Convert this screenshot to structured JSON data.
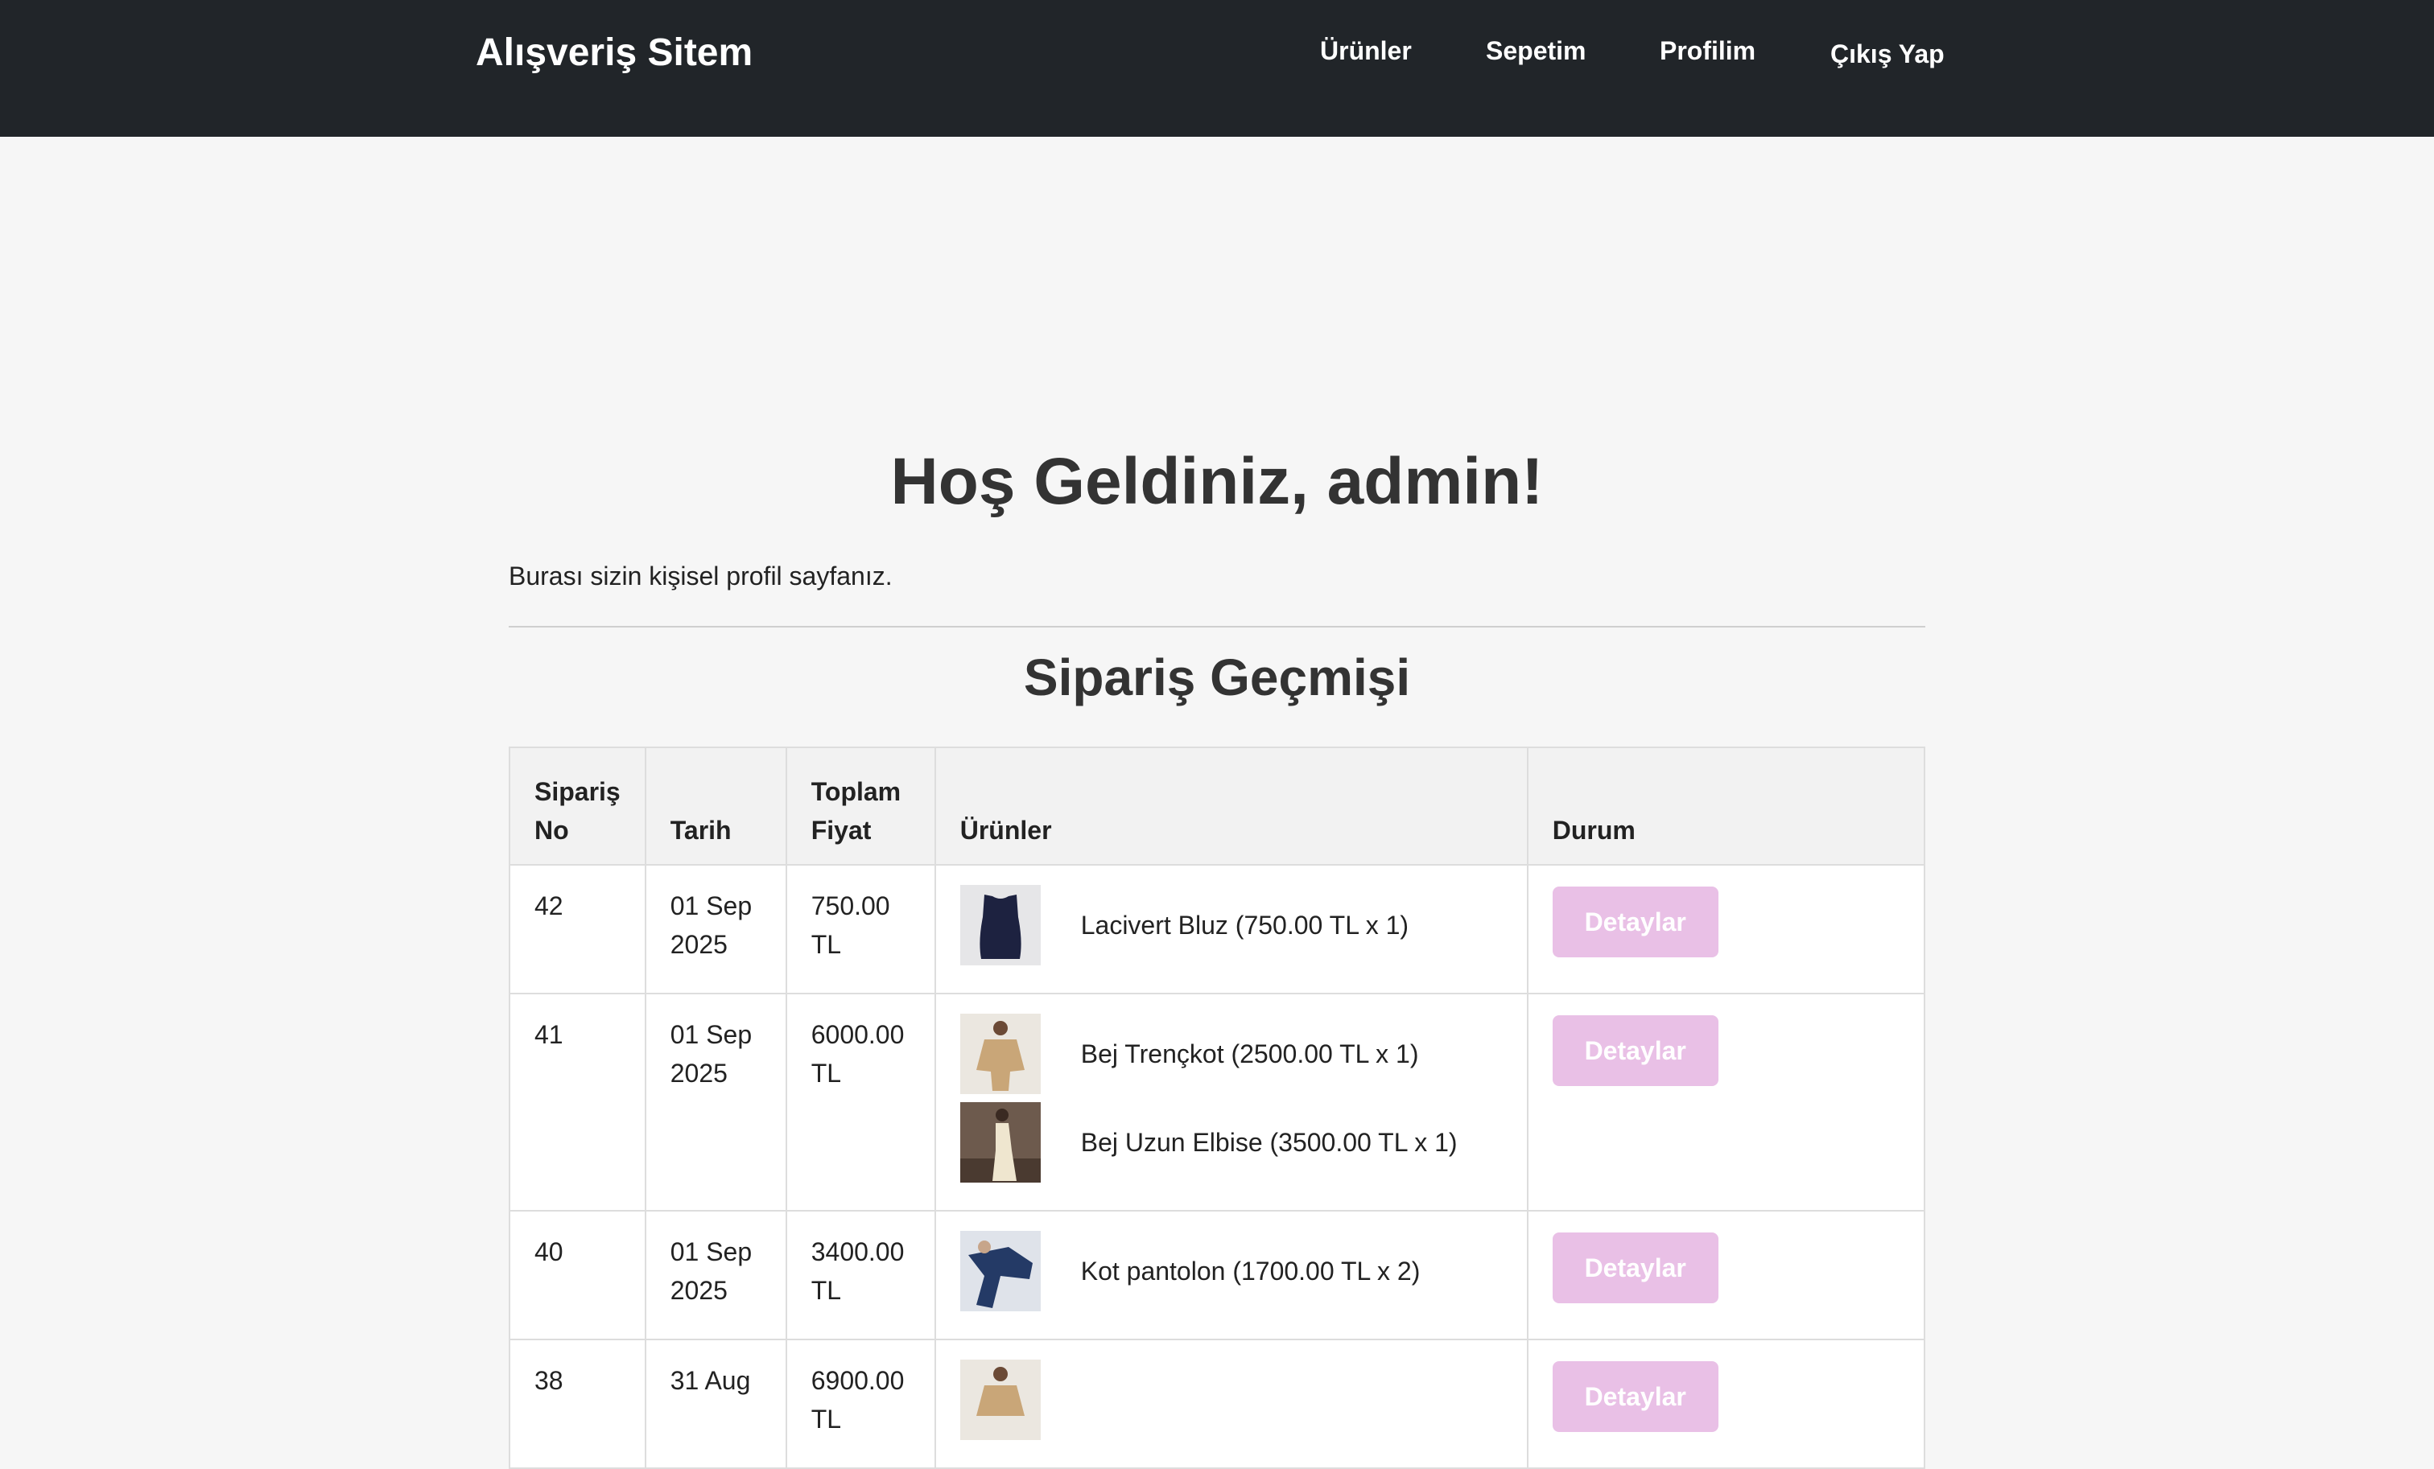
{
  "navbar": {
    "brand": "Alışveriş Sitem",
    "links": [
      "Ürünler",
      "Sepetim",
      "Profilim",
      "Çıkış Yap"
    ]
  },
  "profile": {
    "welcome": "Hoş Geldiniz, admin!",
    "intro": "Burası sizin kişisel profil sayfanız.",
    "history_title": "Sipariş Geçmişi"
  },
  "table": {
    "headers": [
      "Sipariş No",
      "Tarih",
      "Toplam Fiyat",
      "Ürünler",
      "Durum"
    ],
    "rows": [
      {
        "id": "42",
        "date": "01 Sep 2025",
        "total": "750.00 TL",
        "products": [
          {
            "name": "Lacivert Bluz (750.00 TL x 1)",
            "icon": "navy-blouse-thumbnail"
          }
        ],
        "action": "Detaylar"
      },
      {
        "id": "41",
        "date": "01 Sep 2025",
        "total": "6000.00 TL",
        "products": [
          {
            "name": "Bej Trençkot (2500.00 TL x 1)",
            "icon": "beige-trench-coat-thumbnail"
          },
          {
            "name": "Bej Uzun Elbise (3500.00 TL x 1)",
            "icon": "beige-long-dress-thumbnail"
          }
        ],
        "action": "Detaylar"
      },
      {
        "id": "40",
        "date": "01 Sep 2025",
        "total": "3400.00 TL",
        "products": [
          {
            "name": "Kot pantolon (1700.00 TL x 2)",
            "icon": "jeans-thumbnail"
          }
        ],
        "action": "Detaylar"
      },
      {
        "id": "38",
        "date": "31 Aug",
        "total": "6900.00 TL",
        "products": [
          {
            "name": "",
            "icon": "product-thumbnail"
          }
        ],
        "action": "Detaylar"
      }
    ]
  },
  "colors": {
    "navbar": "#212529",
    "button": "#e9c0e6",
    "background": "#f6f6f6"
  }
}
